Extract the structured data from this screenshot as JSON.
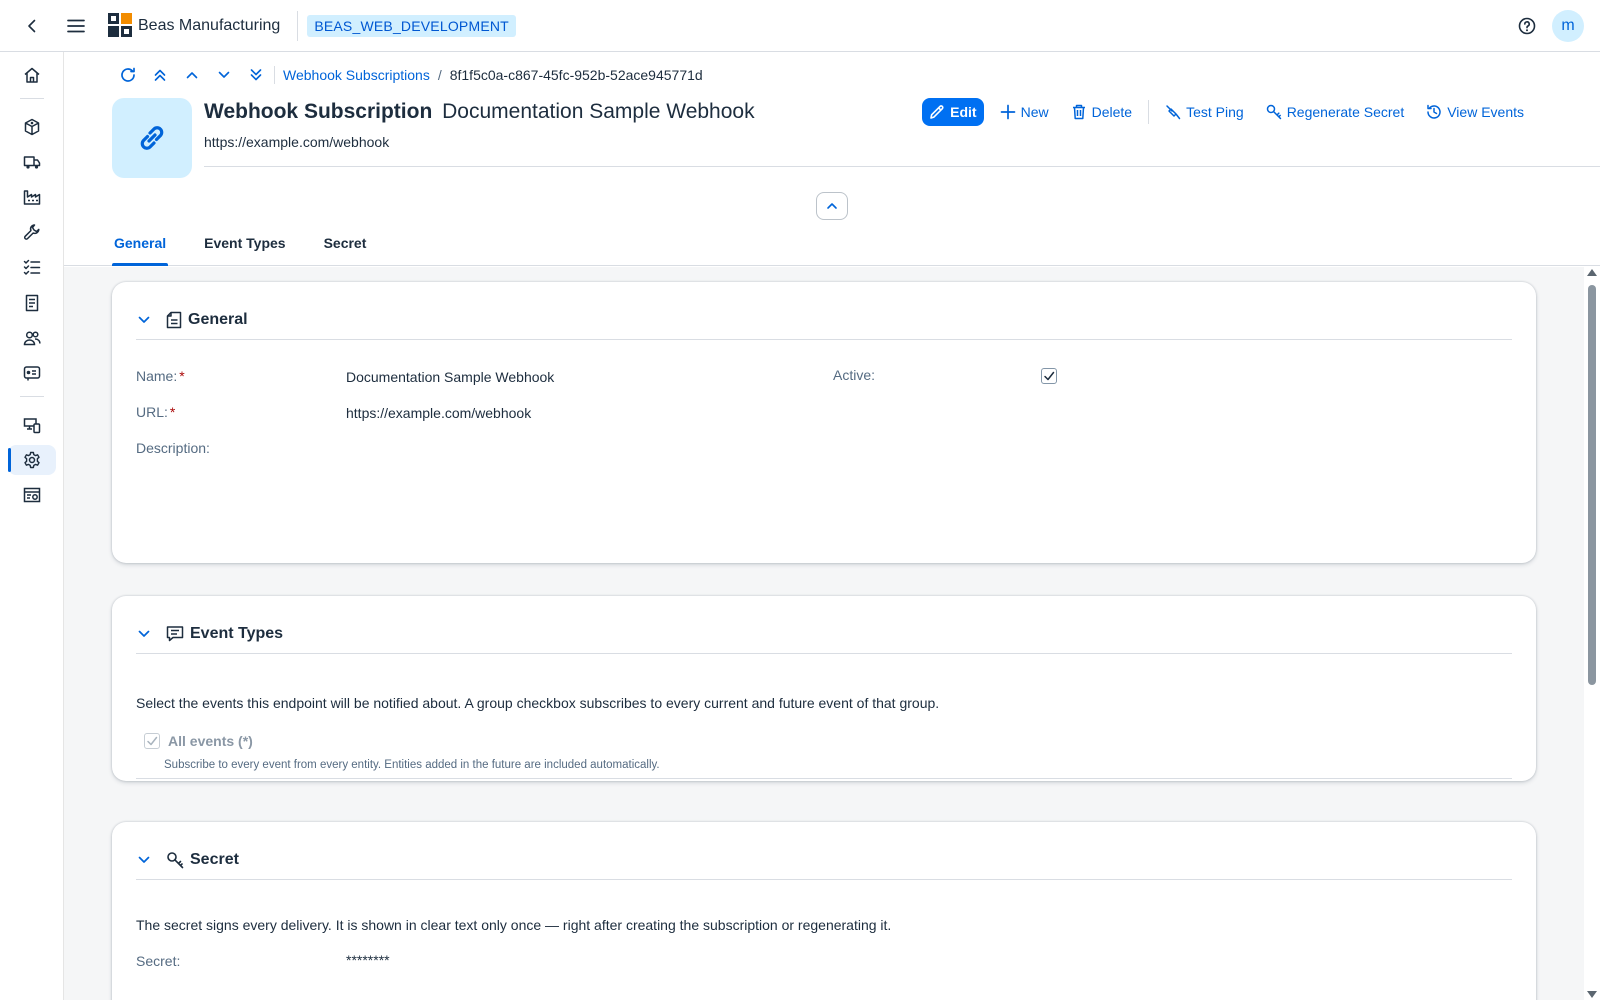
{
  "shell": {
    "app_name": "Beas Manufacturing",
    "environment": "BEAS_WEB_DEVELOPMENT",
    "user_initial": "m"
  },
  "nav": {
    "items": [
      {
        "icon": "home-icon"
      },
      {
        "icon": "cubes-icon"
      },
      {
        "icon": "shipping-truck-icon"
      },
      {
        "icon": "factory-icon"
      },
      {
        "icon": "wrench-icon"
      },
      {
        "icon": "task-list-icon"
      },
      {
        "icon": "document-icon"
      },
      {
        "icon": "people-icon"
      },
      {
        "icon": "production-icon"
      },
      {
        "icon": "devices-icon"
      },
      {
        "icon": "settings-icon"
      },
      {
        "icon": "report-icon"
      }
    ],
    "selected": "settings-icon"
  },
  "breadcrumb": {
    "parent": "Webhook Subscriptions",
    "separator": "/",
    "current": "8f1f5c0a-c867-45fc-952b-52ace945771d"
  },
  "object": {
    "type": "Webhook Subscription",
    "name": "Documentation Sample Webhook",
    "subtitle": "https://example.com/webhook"
  },
  "actions": {
    "edit": "Edit",
    "new": "New",
    "delete": "Delete",
    "test_ping": "Test Ping",
    "regenerate_secret": "Regenerate Secret",
    "view_events": "View Events"
  },
  "tabs": [
    {
      "label": "General",
      "active": true
    },
    {
      "label": "Event Types",
      "active": false
    },
    {
      "label": "Secret",
      "active": false
    }
  ],
  "general": {
    "title": "General",
    "name_label": "Name:",
    "name_value": "Documentation Sample Webhook",
    "url_label": "URL:",
    "url_value": "https://example.com/webhook",
    "description_label": "Description:",
    "description_value": "",
    "active_label": "Active:",
    "active_checked": true,
    "required_marker": "*"
  },
  "event_types": {
    "title": "Event Types",
    "intro": "Select the events this endpoint will be notified about. A group checkbox subscribes to every current and future event of that group.",
    "all_events_label": "All events (*)",
    "all_events_checked": true,
    "all_events_help": "Subscribe to every event from every entity. Entities added in the future are included automatically."
  },
  "secret": {
    "title": "Secret",
    "intro": "The secret signs every delivery. It is shown in clear text only once — right after creating the subscription or regenerating it.",
    "label": "Secret:",
    "value": "********"
  },
  "colors": {
    "accent": "#0064d9",
    "primary_button": "#0070f2",
    "avatar_bg": "#d1efff",
    "required": "#aa0808"
  }
}
